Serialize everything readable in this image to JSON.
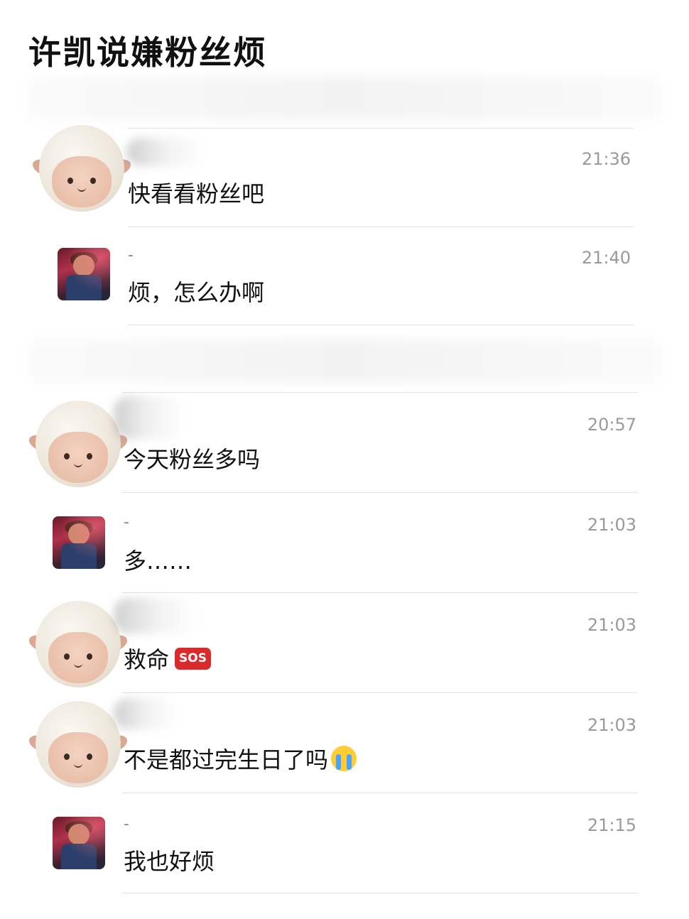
{
  "page": {
    "title": "许凯说嫌粉丝烦"
  },
  "messages": [
    {
      "avatar": "sheep-icon",
      "name_redacted": true,
      "time": "21:36",
      "text": "快看看粉丝吧",
      "emoji": ""
    },
    {
      "avatar": "user-photo",
      "name": "-",
      "time": "21:40",
      "text": "烦，怎么办啊",
      "emoji": ""
    },
    {
      "avatar": "sheep-icon",
      "name_redacted": true,
      "time": "20:57",
      "text": "今天粉丝多吗",
      "emoji": ""
    },
    {
      "avatar": "user-photo",
      "name": "-",
      "time": "21:03",
      "text": "多……",
      "emoji": ""
    },
    {
      "avatar": "sheep-icon",
      "name_redacted": true,
      "time": "21:03",
      "text": "救命",
      "emoji": "SOS"
    },
    {
      "avatar": "sheep-icon",
      "name_redacted": true,
      "time": "21:03",
      "text": "不是都过完生日了吗",
      "emoji": "crying-face"
    },
    {
      "avatar": "user-photo",
      "name": "-",
      "time": "21:15",
      "text": "我也好烦",
      "emoji": ""
    }
  ]
}
